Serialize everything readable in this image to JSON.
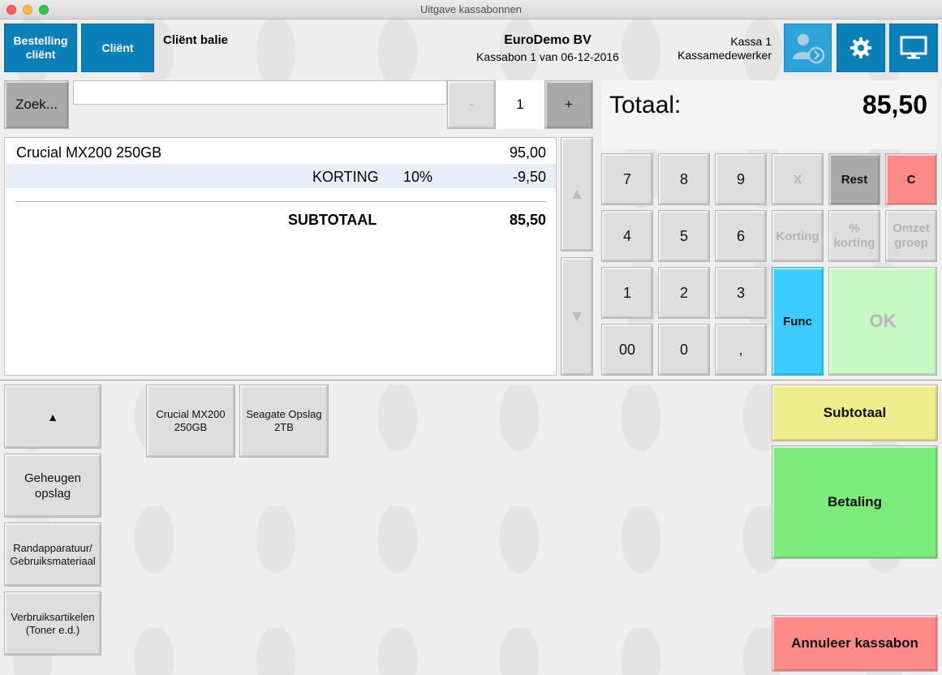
{
  "window": {
    "title": "Uitgave kassabonnen"
  },
  "header": {
    "order_client_label": "Bestelling cliënt",
    "client_label": "Cliënt",
    "client_name": "Cliënt balie",
    "company_name": "EuroDemo BV",
    "receipt_info": "Kassabon 1 van 06-12-2016",
    "register": "Kassa 1",
    "employee": "Kassamedewerker"
  },
  "search": {
    "button_label": "Zoek...",
    "value": ""
  },
  "quantity": {
    "minus": "-",
    "value": "1",
    "plus": "+"
  },
  "total": {
    "label": "Totaal:",
    "value": "85,50"
  },
  "receipt": {
    "items": [
      {
        "description": "Crucial MX200 250GB",
        "amount": "95,00"
      }
    ],
    "discount": {
      "label": "KORTING",
      "percent": "10%",
      "amount": "-9,50"
    },
    "subtotal": {
      "label": "SUBTOTAAL",
      "amount": "85,50"
    }
  },
  "scroll": {
    "up": "▲",
    "down": "▼"
  },
  "keypad": {
    "k7": "7",
    "k8": "8",
    "k9": "9",
    "x": "X",
    "rest": "Rest",
    "c": "C",
    "k4": "4",
    "k5": "5",
    "k6": "6",
    "korting": "Korting",
    "pct_korting": "% korting",
    "omzet_groep": "Omzet groep",
    "k1": "1",
    "k2": "2",
    "k3": "3",
    "func": "Func",
    "ok": "OK",
    "k00": "00",
    "k0": "0",
    "comma": ","
  },
  "categories": {
    "up": "▲",
    "items": [
      {
        "label": "Geheugen opslag"
      },
      {
        "label": "Randapparatuur/ Gebruiksmateriaal"
      },
      {
        "label": "Verbruiksartikelen (Toner e.d.)"
      }
    ]
  },
  "products": [
    {
      "label": "Crucial MX200 250GB"
    },
    {
      "label": "Seagate Opslag 2TB"
    }
  ],
  "actions": {
    "subtotal": "Subtotaal",
    "payment": "Betaling",
    "cancel": "Annuleer kassabon"
  },
  "icons": {
    "client_switch": "user-switch-icon",
    "settings": "gear-icon",
    "display": "monitor-icon"
  }
}
